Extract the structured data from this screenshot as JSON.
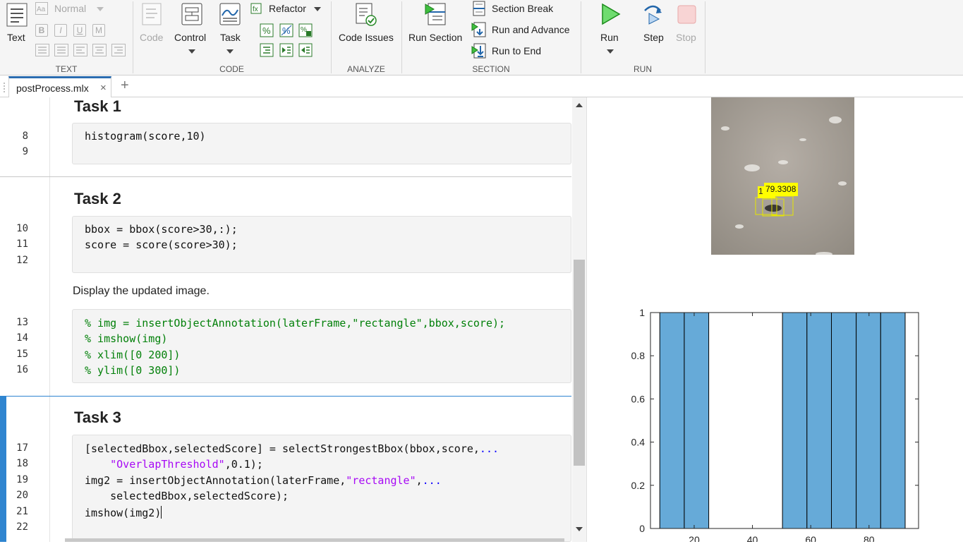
{
  "toolstrip": {
    "text_group": {
      "label": "TEXT",
      "text_button": "Text",
      "style_select": "Normal",
      "format_letters": [
        "B",
        "I",
        "U",
        "M"
      ]
    },
    "code_group": {
      "label": "CODE",
      "code_button": "Code",
      "control_button": "Control",
      "task_button": "Task",
      "refactor_button": "Refactor"
    },
    "analyze_group": {
      "label": "ANALYZE",
      "code_issues_button": "Code Issues"
    },
    "section_group": {
      "label": "SECTION",
      "run_section_button": "Run Section",
      "section_break": "Section Break",
      "run_and_advance": "Run and Advance",
      "run_to_end": "Run to End"
    },
    "run_group": {
      "label": "RUN",
      "run_button": "Run",
      "step_button": "Step",
      "stop_button": "Stop"
    }
  },
  "tabs": [
    {
      "label": "postProcess.mlx",
      "close": "×"
    }
  ],
  "new_tab": "+",
  "editor": {
    "sections": [
      {
        "heading": "Task 1",
        "line_numbers": [
          "8",
          "9"
        ],
        "code": [
          "histogram(score,10)"
        ]
      },
      {
        "heading": "Task 2",
        "line_numbers": [
          "10",
          "11",
          "12"
        ],
        "code": [
          "bbox = bbox(score>30,:);",
          "score = score(score>30);"
        ],
        "prose": "Display the updated image.",
        "line_numbers_2": [
          "13",
          "14",
          "15",
          "16"
        ],
        "code_2": [
          "% img = insertObjectAnnotation(laterFrame,\"rectangle\",bbox,score);",
          "% imshow(img)",
          "% xlim([0 200])",
          "% ylim([0 300])"
        ]
      },
      {
        "heading": "Task 3",
        "line_numbers": [
          "17",
          "18",
          "19",
          "20",
          "21",
          "22"
        ],
        "code": [
          {
            "a": "[selectedBbox,selectedScore] = selectStrongestBbox(bbox,score,",
            "b": "..."
          },
          {
            "a": "    ",
            "s": "\"OverlapThreshold\"",
            "c": ",0.1);"
          },
          {
            "a": "img2 = insertObjectAnnotation(laterFrame,",
            "s": "\"rectangle\"",
            "c": ",",
            "b": "..."
          },
          {
            "a": "    selectedBbox,selectedScore);"
          },
          {
            "a": "imshow(img2)"
          }
        ]
      }
    ]
  },
  "output": {
    "image_annotation": "79.3308",
    "image_annotation_prefix": "1",
    "colors": {
      "bar": "#66aad8",
      "annotation": "#ffff00"
    }
  },
  "chart_data": {
    "type": "bar",
    "x_ticks": [
      "20",
      "40",
      "60",
      "80"
    ],
    "y_ticks": [
      "0",
      "0.2",
      "0.4",
      "0.6",
      "0.8",
      "1"
    ],
    "xlim": [
      5,
      97
    ],
    "ylim": [
      0,
      1
    ],
    "bin_edges": [
      8.2,
      16.6,
      25.0,
      33.5,
      41.9,
      50.3,
      58.7,
      67.1,
      75.6,
      84.0,
      92.4
    ],
    "values": [
      1,
      1,
      0,
      0,
      0,
      1,
      1,
      1,
      1,
      1
    ]
  }
}
